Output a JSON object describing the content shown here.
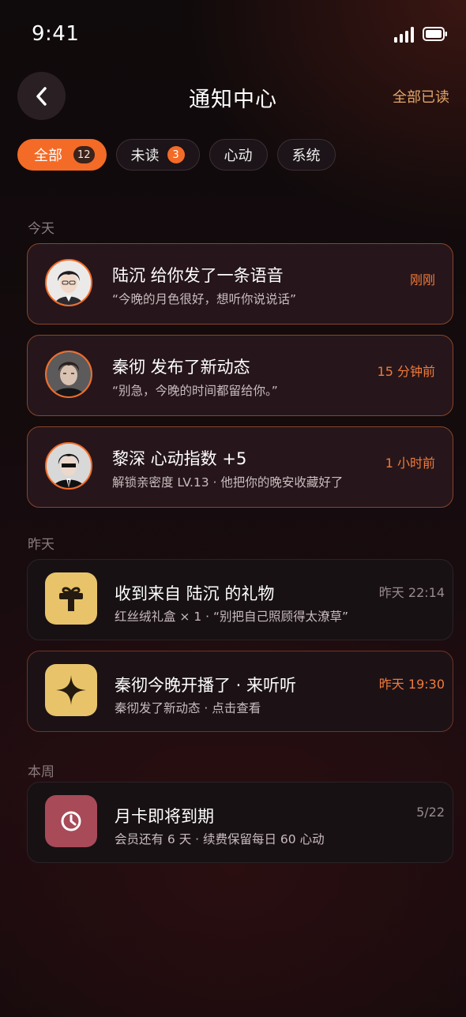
{
  "status_bar": {
    "time": "9:41"
  },
  "header": {
    "title": "通知中心",
    "mark_all_read": "全部已读"
  },
  "tabs": [
    {
      "label": "全部",
      "badge": "12",
      "active": true
    },
    {
      "label": "未读",
      "badge": "3"
    },
    {
      "label": "心动"
    },
    {
      "label": "系统"
    }
  ],
  "sections": {
    "today": "今天",
    "yesterday": "昨天",
    "this_week": "本周"
  },
  "notifications": [
    {
      "title": "陆沉 给你发了一条语音",
      "subtitle": "“今晚的月色很好，想听你说说话”",
      "time": "刚刚",
      "avatar": "lu-chen-avatar"
    },
    {
      "title": "秦彻 发布了新动态",
      "subtitle": "“别急，今晚的时间都留给你。”",
      "time": "15 分钟前",
      "avatar": "qin-che-avatar"
    },
    {
      "title": "黎深 心动指数 +5",
      "subtitle": "解锁亲密度 LV.13 · 他把你的晚安收藏好了",
      "time": "1 小时前",
      "avatar": "li-shen-avatar"
    },
    {
      "title": "收到来自 陆沉 的礼物",
      "subtitle": "红丝绒礼盒 × 1 · “别把自己照顾得太潦草”",
      "time": "昨天 22:14",
      "icon": "gift-icon"
    },
    {
      "title": "秦彻今晚开播了 · 来听听",
      "subtitle": "秦彻发了新动态 · 点击查看",
      "time": "昨天 19:30",
      "icon": "sparkle-icon"
    },
    {
      "title": "月卡即将到期",
      "subtitle": "会员还有 6 天 · 续费保留每日 60 心动",
      "time": "5/22",
      "icon": "clock-icon"
    }
  ],
  "colors": {
    "accent": "#f36b27",
    "mark_all": "#e3a668",
    "gift_tile": "#e8c36a",
    "clock_tile": "#a84a58"
  }
}
